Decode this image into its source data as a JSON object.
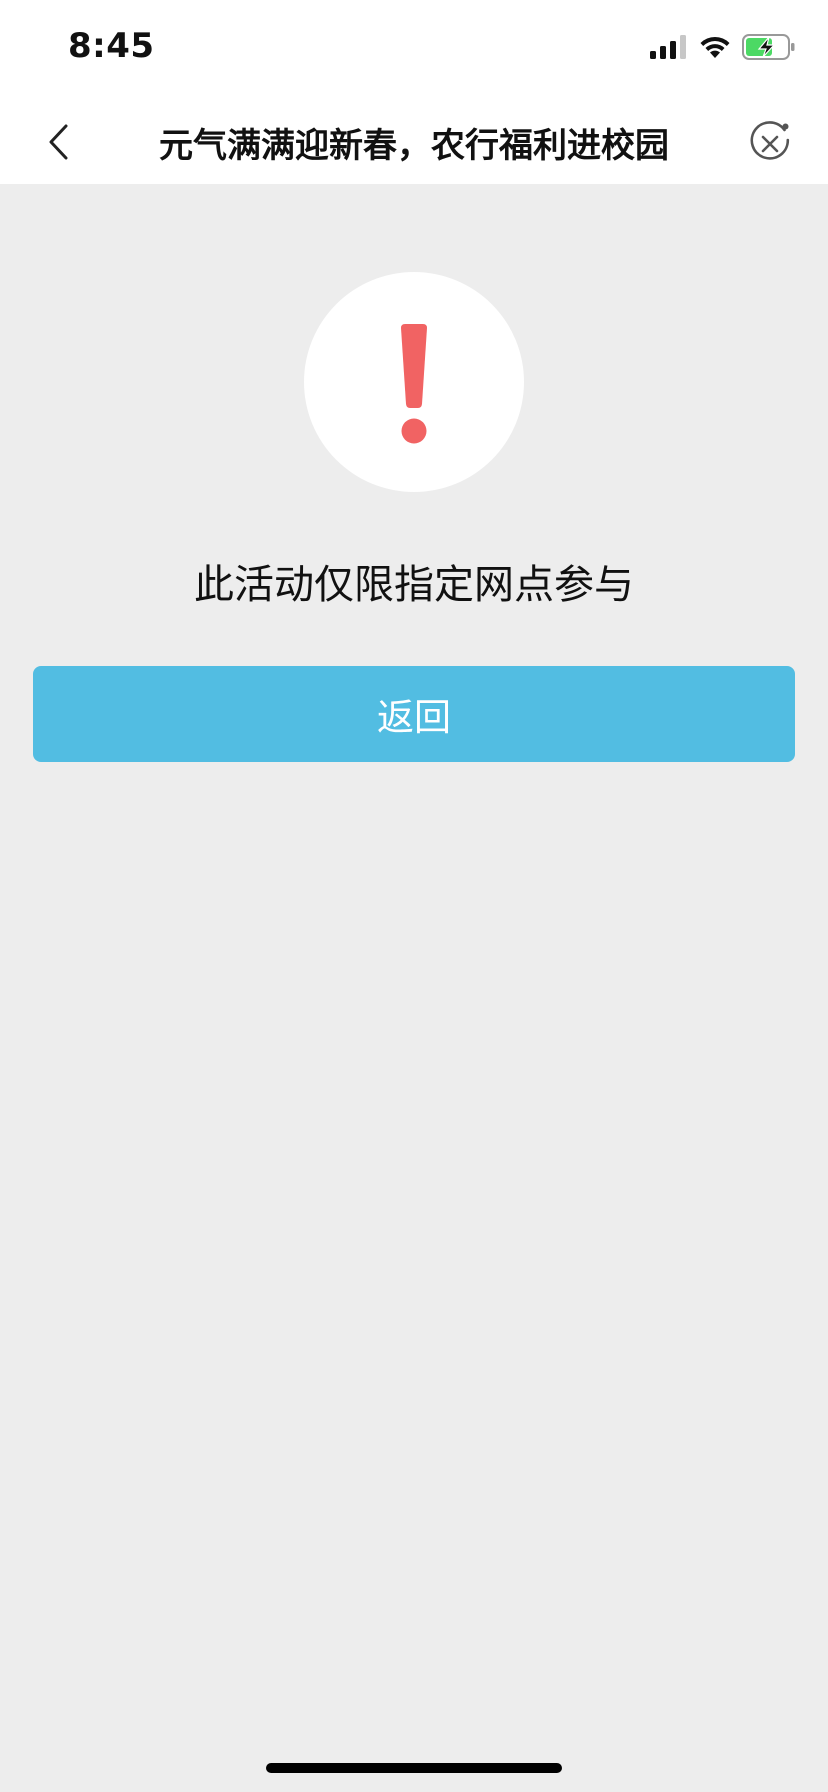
{
  "status_bar": {
    "time": "8:45",
    "icons": [
      "cellular-signal-icon",
      "wifi-icon",
      "battery-charging-icon"
    ]
  },
  "nav": {
    "title": "元气满满迎新春，农行福利进校园",
    "back_icon": "chevron-left-icon",
    "close_icon": "close-circle-icon"
  },
  "alert": {
    "icon": "exclamation-icon",
    "icon_color": "#F16363",
    "message": "此活动仅限指定网点参与"
  },
  "actions": {
    "back_label": "返回",
    "button_color": "#52BDE2"
  },
  "theme": {
    "background": "#EDEDED",
    "bar_background": "#FFFFFF",
    "battery_color": "#4CD964"
  }
}
